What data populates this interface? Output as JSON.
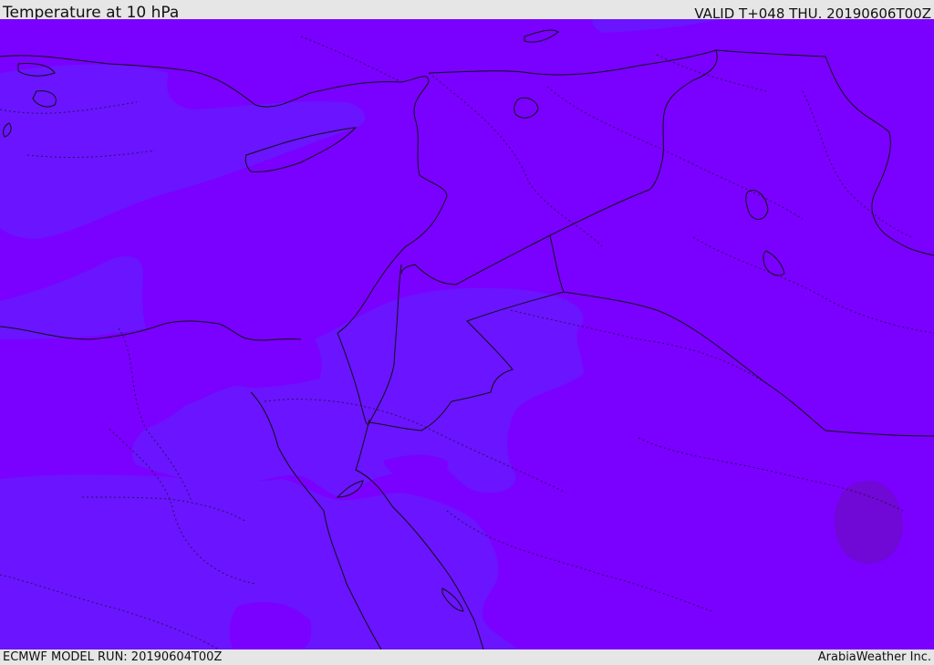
{
  "header": {
    "title": "Temperature at 10 hPa",
    "valid": "VALID T+048 THU. 20190606T00Z"
  },
  "footer": {
    "model_run": "ECMWF MODEL RUN: 20190604T00Z",
    "credit": "ArabiaWeather Inc."
  },
  "colors": {
    "base_field": "#7a00ff",
    "cooler_field": "#6a14ff",
    "warm_cell": "#7008d6",
    "border_line": "#111111"
  }
}
